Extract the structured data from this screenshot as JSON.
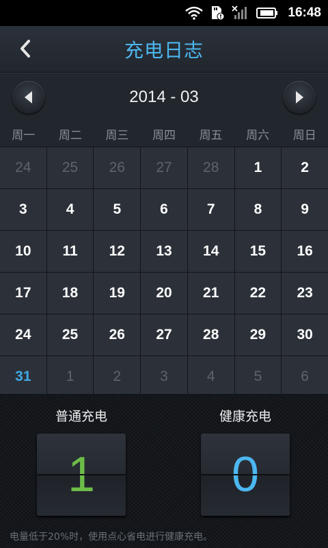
{
  "status_bar": {
    "time": "16:48",
    "icons": [
      "wifi-icon",
      "sd-notification-icon",
      "no-signal-icon",
      "battery-icon"
    ]
  },
  "header": {
    "back_icon": "chevron-left-icon",
    "title": "充电日志"
  },
  "month_nav": {
    "prev_icon": "triangle-left-icon",
    "month": "2014 - 03",
    "next_icon": "triangle-right-icon"
  },
  "weekdays": [
    "周一",
    "周二",
    "周三",
    "周四",
    "周五",
    "周六",
    "周日"
  ],
  "days": [
    {
      "label": "24",
      "state": "other"
    },
    {
      "label": "25",
      "state": "other"
    },
    {
      "label": "26",
      "state": "other"
    },
    {
      "label": "27",
      "state": "other"
    },
    {
      "label": "28",
      "state": "other"
    },
    {
      "label": "1",
      "state": "current"
    },
    {
      "label": "2",
      "state": "current"
    },
    {
      "label": "3",
      "state": "current"
    },
    {
      "label": "4",
      "state": "current"
    },
    {
      "label": "5",
      "state": "current"
    },
    {
      "label": "6",
      "state": "current"
    },
    {
      "label": "7",
      "state": "current"
    },
    {
      "label": "8",
      "state": "current"
    },
    {
      "label": "9",
      "state": "current"
    },
    {
      "label": "10",
      "state": "current"
    },
    {
      "label": "11",
      "state": "current"
    },
    {
      "label": "12",
      "state": "current"
    },
    {
      "label": "13",
      "state": "current"
    },
    {
      "label": "14",
      "state": "current"
    },
    {
      "label": "15",
      "state": "current"
    },
    {
      "label": "16",
      "state": "current"
    },
    {
      "label": "17",
      "state": "current"
    },
    {
      "label": "18",
      "state": "current"
    },
    {
      "label": "19",
      "state": "current"
    },
    {
      "label": "20",
      "state": "current"
    },
    {
      "label": "21",
      "state": "current"
    },
    {
      "label": "22",
      "state": "current"
    },
    {
      "label": "23",
      "state": "current"
    },
    {
      "label": "24",
      "state": "current"
    },
    {
      "label": "25",
      "state": "current"
    },
    {
      "label": "26",
      "state": "current"
    },
    {
      "label": "27",
      "state": "current"
    },
    {
      "label": "28",
      "state": "current"
    },
    {
      "label": "29",
      "state": "current"
    },
    {
      "label": "30",
      "state": "current"
    },
    {
      "label": "31",
      "state": "today"
    },
    {
      "label": "1",
      "state": "other"
    },
    {
      "label": "2",
      "state": "other"
    },
    {
      "label": "3",
      "state": "other"
    },
    {
      "label": "4",
      "state": "other"
    },
    {
      "label": "5",
      "state": "other"
    },
    {
      "label": "6",
      "state": "other"
    }
  ],
  "summary": {
    "normal": {
      "label": "普通充电",
      "count": "1",
      "color": "#6dbe49"
    },
    "healthy": {
      "label": "健康充电",
      "count": "0",
      "color": "#4cb7f0"
    },
    "hint": "电量低于20%时，使用点心省电进行健康充电。"
  },
  "colors": {
    "accent": "#4cb7f0",
    "today": "#3fa9e6",
    "other_month_day": "#5e646c"
  }
}
